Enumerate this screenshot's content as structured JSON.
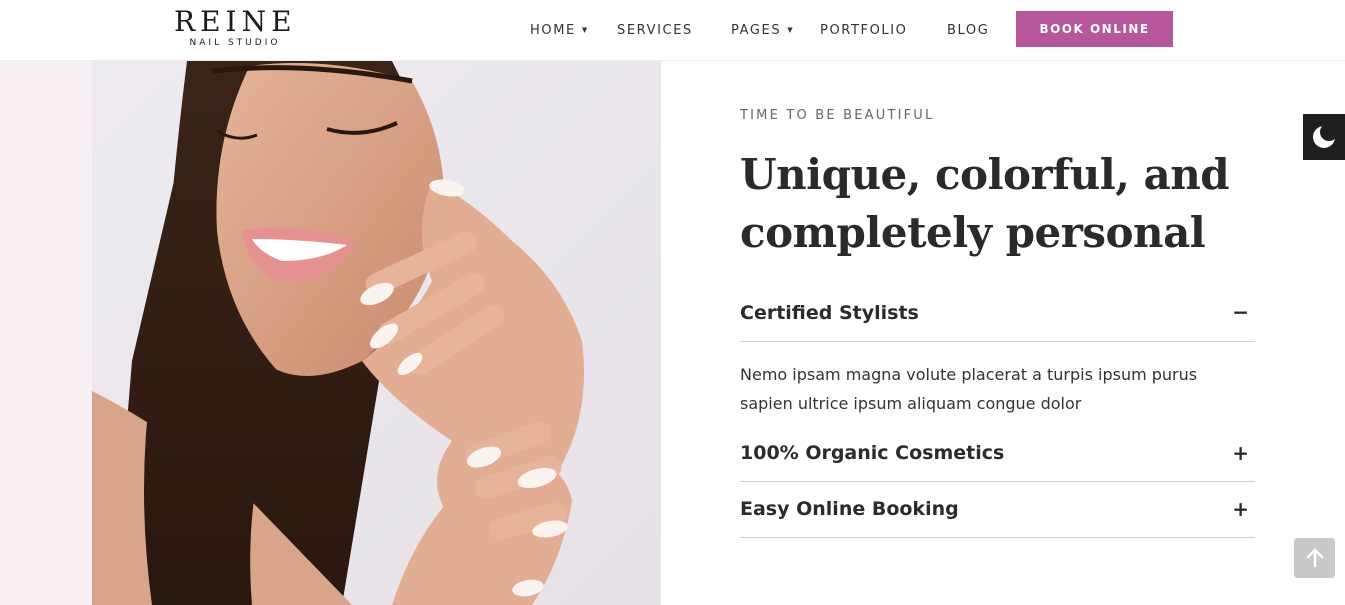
{
  "brand": {
    "name": "REINE",
    "tagline": "NAIL STUDIO"
  },
  "nav": {
    "items": [
      {
        "label": "HOME",
        "has_dropdown": true
      },
      {
        "label": "SERVICES",
        "has_dropdown": false
      },
      {
        "label": "PAGES",
        "has_dropdown": true
      },
      {
        "label": "PORTFOLIO",
        "has_dropdown": false
      },
      {
        "label": "BLOG",
        "has_dropdown": false
      }
    ],
    "cta_label": "BOOK ONLINE"
  },
  "hero": {
    "eyebrow": "TIME TO BE BEAUTIFUL",
    "headline_line1": "Unique, colorful, and",
    "headline_line2": "completely personal"
  },
  "accordion": {
    "items": [
      {
        "title": "Certified Stylists",
        "icon": "minus-icon",
        "expanded": true,
        "body": "Nemo ipsam magna volute placerat a turpis ipsum purus sapien ultrice ipsum aliquam congue dolor"
      },
      {
        "title": "100% Organic Cosmetics",
        "icon": "plus-icon",
        "expanded": false
      },
      {
        "title": "Easy Online Booking",
        "icon": "plus-icon",
        "expanded": false
      }
    ]
  },
  "widgets": {
    "dark_mode_icon": "moon-icon",
    "scroll_top_icon": "arrow-up-icon"
  },
  "colors": {
    "accent": "#b5579a",
    "strip": "#f8eff5",
    "dark_toggle": "#1f1f1f"
  }
}
